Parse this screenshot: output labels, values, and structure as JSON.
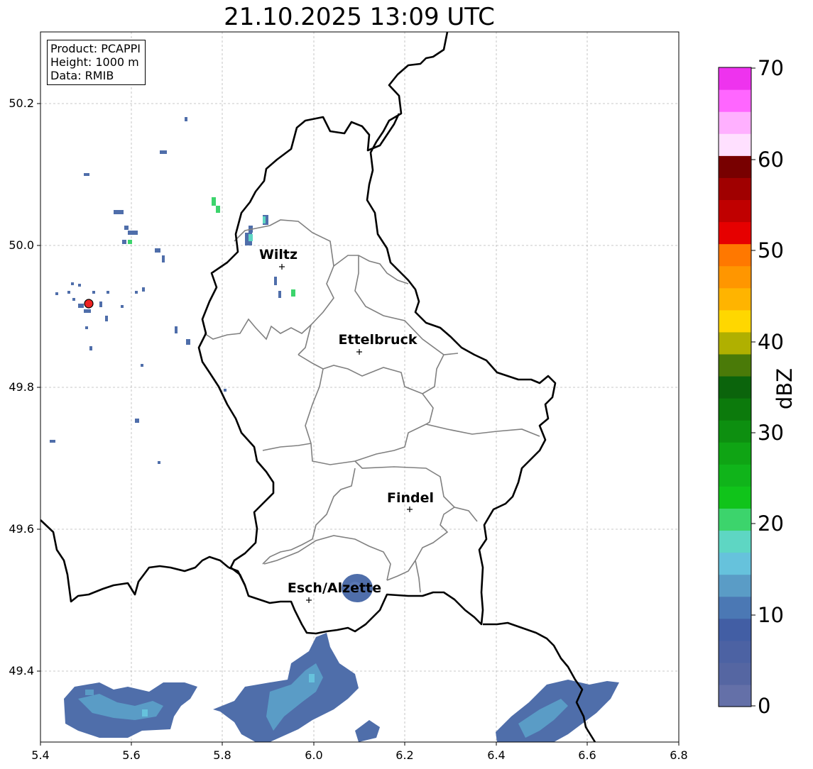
{
  "title": "21.10.2025 13:09 UTC",
  "info_box": {
    "product": "Product: PCAPPI",
    "height": "Height: 1000 m",
    "source": "Data: RMIB"
  },
  "axes": {
    "x_ticks": [
      "5.4",
      "5.6",
      "5.8",
      "6.0",
      "6.2",
      "6.4",
      "6.6",
      "6.8"
    ],
    "y_ticks": [
      "50.2",
      "50.0",
      "49.8",
      "49.6",
      "49.4"
    ],
    "xlim": [
      5.4,
      6.8
    ],
    "ylim": [
      49.3,
      50.3
    ],
    "grid": true
  },
  "colorbar": {
    "unit": "dBZ",
    "labels": [
      "70",
      "60",
      "50",
      "40",
      "30",
      "20",
      "10",
      "0"
    ],
    "colors": [
      "#6470a8",
      "#5566a2",
      "#4c62a3",
      "#425ea4",
      "#4b78b4",
      "#5a9cc6",
      "#66c2dc",
      "#5ed6c3",
      "#3cd46c",
      "#10c41a",
      "#10b41a",
      "#0fa414",
      "#0d8f10",
      "#0c7a0c",
      "#0b640c",
      "#4a7a08",
      "#b0b000",
      "#ffd700",
      "#ffb400",
      "#ff9600",
      "#ff7800",
      "#e60000",
      "#c00000",
      "#a00000",
      "#780000",
      "#ffe0ff",
      "#ffb0ff",
      "#ff66ff",
      "#ee33ee"
    ]
  },
  "cities": [
    {
      "name": "Wiltz",
      "lon": 5.93,
      "lat": 49.97
    },
    {
      "name": "Ettelbruck",
      "lon": 6.1,
      "lat": 49.85
    },
    {
      "name": "Findel",
      "lon": 6.21,
      "lat": 49.63
    },
    {
      "name": "Esch/Alzette",
      "lon": 5.99,
      "lat": 49.5
    }
  ],
  "radar_site": {
    "lon": 5.505,
    "lat": 49.915,
    "color": "#ee2222"
  }
}
